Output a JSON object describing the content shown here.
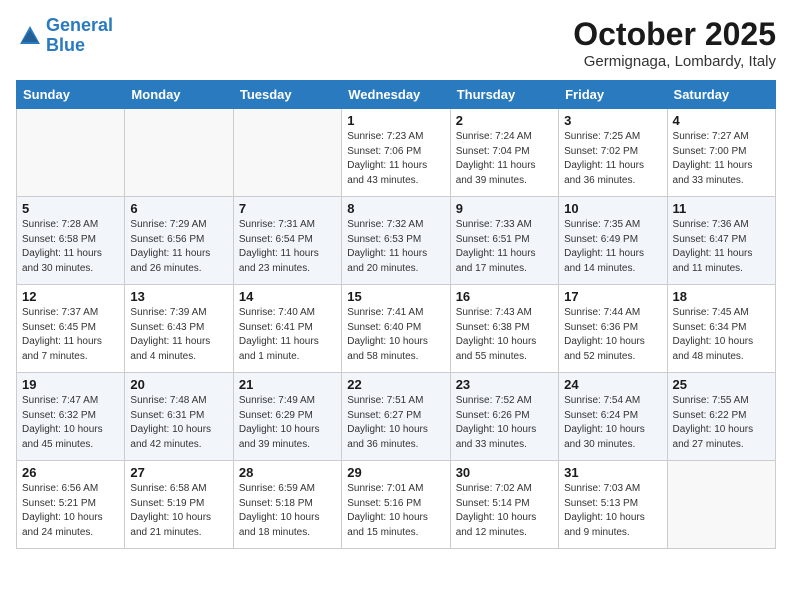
{
  "header": {
    "logo_line1": "General",
    "logo_line2": "Blue",
    "month": "October 2025",
    "location": "Germignaga, Lombardy, Italy"
  },
  "weekdays": [
    "Sunday",
    "Monday",
    "Tuesday",
    "Wednesday",
    "Thursday",
    "Friday",
    "Saturday"
  ],
  "weeks": [
    [
      {
        "day": "",
        "info": ""
      },
      {
        "day": "",
        "info": ""
      },
      {
        "day": "",
        "info": ""
      },
      {
        "day": "1",
        "info": "Sunrise: 7:23 AM\nSunset: 7:06 PM\nDaylight: 11 hours\nand 43 minutes."
      },
      {
        "day": "2",
        "info": "Sunrise: 7:24 AM\nSunset: 7:04 PM\nDaylight: 11 hours\nand 39 minutes."
      },
      {
        "day": "3",
        "info": "Sunrise: 7:25 AM\nSunset: 7:02 PM\nDaylight: 11 hours\nand 36 minutes."
      },
      {
        "day": "4",
        "info": "Sunrise: 7:27 AM\nSunset: 7:00 PM\nDaylight: 11 hours\nand 33 minutes."
      }
    ],
    [
      {
        "day": "5",
        "info": "Sunrise: 7:28 AM\nSunset: 6:58 PM\nDaylight: 11 hours\nand 30 minutes."
      },
      {
        "day": "6",
        "info": "Sunrise: 7:29 AM\nSunset: 6:56 PM\nDaylight: 11 hours\nand 26 minutes."
      },
      {
        "day": "7",
        "info": "Sunrise: 7:31 AM\nSunset: 6:54 PM\nDaylight: 11 hours\nand 23 minutes."
      },
      {
        "day": "8",
        "info": "Sunrise: 7:32 AM\nSunset: 6:53 PM\nDaylight: 11 hours\nand 20 minutes."
      },
      {
        "day": "9",
        "info": "Sunrise: 7:33 AM\nSunset: 6:51 PM\nDaylight: 11 hours\nand 17 minutes."
      },
      {
        "day": "10",
        "info": "Sunrise: 7:35 AM\nSunset: 6:49 PM\nDaylight: 11 hours\nand 14 minutes."
      },
      {
        "day": "11",
        "info": "Sunrise: 7:36 AM\nSunset: 6:47 PM\nDaylight: 11 hours\nand 11 minutes."
      }
    ],
    [
      {
        "day": "12",
        "info": "Sunrise: 7:37 AM\nSunset: 6:45 PM\nDaylight: 11 hours\nand 7 minutes."
      },
      {
        "day": "13",
        "info": "Sunrise: 7:39 AM\nSunset: 6:43 PM\nDaylight: 11 hours\nand 4 minutes."
      },
      {
        "day": "14",
        "info": "Sunrise: 7:40 AM\nSunset: 6:41 PM\nDaylight: 11 hours\nand 1 minute."
      },
      {
        "day": "15",
        "info": "Sunrise: 7:41 AM\nSunset: 6:40 PM\nDaylight: 10 hours\nand 58 minutes."
      },
      {
        "day": "16",
        "info": "Sunrise: 7:43 AM\nSunset: 6:38 PM\nDaylight: 10 hours\nand 55 minutes."
      },
      {
        "day": "17",
        "info": "Sunrise: 7:44 AM\nSunset: 6:36 PM\nDaylight: 10 hours\nand 52 minutes."
      },
      {
        "day": "18",
        "info": "Sunrise: 7:45 AM\nSunset: 6:34 PM\nDaylight: 10 hours\nand 48 minutes."
      }
    ],
    [
      {
        "day": "19",
        "info": "Sunrise: 7:47 AM\nSunset: 6:32 PM\nDaylight: 10 hours\nand 45 minutes."
      },
      {
        "day": "20",
        "info": "Sunrise: 7:48 AM\nSunset: 6:31 PM\nDaylight: 10 hours\nand 42 minutes."
      },
      {
        "day": "21",
        "info": "Sunrise: 7:49 AM\nSunset: 6:29 PM\nDaylight: 10 hours\nand 39 minutes."
      },
      {
        "day": "22",
        "info": "Sunrise: 7:51 AM\nSunset: 6:27 PM\nDaylight: 10 hours\nand 36 minutes."
      },
      {
        "day": "23",
        "info": "Sunrise: 7:52 AM\nSunset: 6:26 PM\nDaylight: 10 hours\nand 33 minutes."
      },
      {
        "day": "24",
        "info": "Sunrise: 7:54 AM\nSunset: 6:24 PM\nDaylight: 10 hours\nand 30 minutes."
      },
      {
        "day": "25",
        "info": "Sunrise: 7:55 AM\nSunset: 6:22 PM\nDaylight: 10 hours\nand 27 minutes."
      }
    ],
    [
      {
        "day": "26",
        "info": "Sunrise: 6:56 AM\nSunset: 5:21 PM\nDaylight: 10 hours\nand 24 minutes."
      },
      {
        "day": "27",
        "info": "Sunrise: 6:58 AM\nSunset: 5:19 PM\nDaylight: 10 hours\nand 21 minutes."
      },
      {
        "day": "28",
        "info": "Sunrise: 6:59 AM\nSunset: 5:18 PM\nDaylight: 10 hours\nand 18 minutes."
      },
      {
        "day": "29",
        "info": "Sunrise: 7:01 AM\nSunset: 5:16 PM\nDaylight: 10 hours\nand 15 minutes."
      },
      {
        "day": "30",
        "info": "Sunrise: 7:02 AM\nSunset: 5:14 PM\nDaylight: 10 hours\nand 12 minutes."
      },
      {
        "day": "31",
        "info": "Sunrise: 7:03 AM\nSunset: 5:13 PM\nDaylight: 10 hours\nand 9 minutes."
      },
      {
        "day": "",
        "info": ""
      }
    ]
  ]
}
